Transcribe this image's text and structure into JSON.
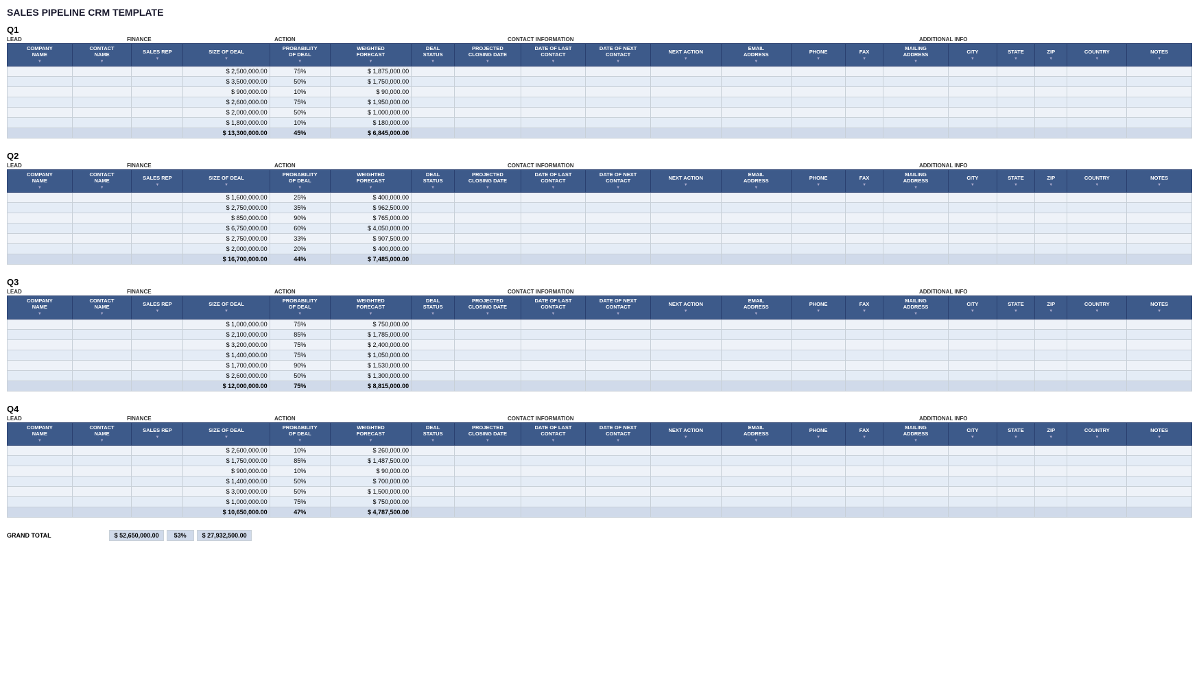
{
  "title": "SALES PIPELINE CRM TEMPLATE",
  "quarters": [
    {
      "label": "Q1",
      "categories": {
        "lead": "LEAD",
        "finance": "FINANCE",
        "action": "ACTION",
        "contact": "CONTACT INFORMATION",
        "addinfo": "ADDITIONAL INFO"
      },
      "columns": [
        "COMPANY NAME",
        "CONTACT NAME",
        "SALES REP",
        "SIZE OF DEAL",
        "PROBABILITY OF DEAL",
        "WEIGHTED FORECAST",
        "DEAL STATUS",
        "PROJECTED CLOSING DATE",
        "DATE OF LAST CONTACT",
        "DATE OF NEXT CONTACT",
        "NEXT ACTION",
        "EMAIL ADDRESS",
        "PHONE",
        "FAX",
        "MAILING ADDRESS",
        "CITY",
        "STATE",
        "ZIP",
        "COUNTRY",
        "NOTES"
      ],
      "rows": [
        {
          "deal": "2,500,000.00",
          "prob": "75%",
          "forecast": "1,875,000.00"
        },
        {
          "deal": "3,500,000.00",
          "prob": "50%",
          "forecast": "1,750,000.00"
        },
        {
          "deal": "900,000.00",
          "prob": "10%",
          "forecast": "90,000.00"
        },
        {
          "deal": "2,600,000.00",
          "prob": "75%",
          "forecast": "1,950,000.00"
        },
        {
          "deal": "2,000,000.00",
          "prob": "50%",
          "forecast": "1,000,000.00"
        },
        {
          "deal": "1,800,000.00",
          "prob": "10%",
          "forecast": "180,000.00"
        }
      ],
      "total": {
        "deal": "13,300,000.00",
        "prob": "45%",
        "forecast": "6,845,000.00"
      }
    },
    {
      "label": "Q2",
      "categories": {
        "lead": "LEAD",
        "finance": "FINANCE",
        "action": "ACTION",
        "contact": "CONTACT INFORMATION",
        "addinfo": "ADDITIONAL INFO"
      },
      "columns": [
        "COMPANY NAME",
        "CONTACT NAME",
        "SALES REP",
        "SIZE OF DEAL",
        "PROBABILITY OF DEAL",
        "WEIGHTED FORECAST",
        "DEAL STATUS",
        "PROJECTED CLOSING DATE",
        "DATE OF LAST CONTACT",
        "DATE OF NEXT CONTACT",
        "NEXT ACTION",
        "EMAIL ADDRESS",
        "PHONE",
        "FAX",
        "MAILING ADDRESS",
        "CITY",
        "STATE",
        "ZIP",
        "COUNTRY",
        "NOTES"
      ],
      "rows": [
        {
          "deal": "1,600,000.00",
          "prob": "25%",
          "forecast": "400,000.00"
        },
        {
          "deal": "2,750,000.00",
          "prob": "35%",
          "forecast": "962,500.00"
        },
        {
          "deal": "850,000.00",
          "prob": "90%",
          "forecast": "765,000.00"
        },
        {
          "deal": "6,750,000.00",
          "prob": "60%",
          "forecast": "4,050,000.00"
        },
        {
          "deal": "2,750,000.00",
          "prob": "33%",
          "forecast": "907,500.00"
        },
        {
          "deal": "2,000,000.00",
          "prob": "20%",
          "forecast": "400,000.00"
        }
      ],
      "total": {
        "deal": "16,700,000.00",
        "prob": "44%",
        "forecast": "7,485,000.00"
      }
    },
    {
      "label": "Q3",
      "categories": {
        "lead": "LEAD",
        "finance": "FINANCE",
        "action": "ACTION",
        "contact": "CONTACT INFORMATION",
        "addinfo": "ADDITIONAL INFO"
      },
      "columns": [
        "COMPANY NAME",
        "CONTACT NAME",
        "SALES REP",
        "SIZE OF DEAL",
        "PROBABILITY OF DEAL",
        "WEIGHTED FORECAST",
        "DEAL STATUS",
        "PROJECTED CLOSING DATE",
        "DATE OF LAST CONTACT",
        "DATE OF NEXT CONTACT",
        "NEXT ACTION",
        "EMAIL ADDRESS",
        "PHONE",
        "FAX",
        "MAILING ADDRESS",
        "CITY",
        "STATE",
        "ZIP",
        "COUNTRY",
        "NOTES"
      ],
      "rows": [
        {
          "deal": "1,000,000.00",
          "prob": "75%",
          "forecast": "750,000.00"
        },
        {
          "deal": "2,100,000.00",
          "prob": "85%",
          "forecast": "1,785,000.00"
        },
        {
          "deal": "3,200,000.00",
          "prob": "75%",
          "forecast": "2,400,000.00"
        },
        {
          "deal": "1,400,000.00",
          "prob": "75%",
          "forecast": "1,050,000.00"
        },
        {
          "deal": "1,700,000.00",
          "prob": "90%",
          "forecast": "1,530,000.00"
        },
        {
          "deal": "2,600,000.00",
          "prob": "50%",
          "forecast": "1,300,000.00"
        }
      ],
      "total": {
        "deal": "12,000,000.00",
        "prob": "75%",
        "forecast": "8,815,000.00"
      }
    },
    {
      "label": "Q4",
      "categories": {
        "lead": "LEAD",
        "finance": "FINANCE",
        "action": "ACTION",
        "contact": "CONTACT INFORMATION",
        "addinfo": "ADDITIONAL INFO"
      },
      "columns": [
        "COMPANY NAME",
        "CONTACT NAME",
        "SALES REP",
        "SIZE OF DEAL",
        "PROBABILITY OF DEAL",
        "WEIGHTED FORECAST",
        "DEAL STATUS",
        "PROJECTED CLOSING DATE",
        "DATE OF LAST CONTACT",
        "DATE OF NEXT CONTACT",
        "NEXT ACTION",
        "EMAIL ADDRESS",
        "PHONE",
        "FAX",
        "MAILING ADDRESS",
        "CITY",
        "STATE",
        "ZIP",
        "COUNTRY",
        "NOTES"
      ],
      "rows": [
        {
          "deal": "2,600,000.00",
          "prob": "10%",
          "forecast": "260,000.00"
        },
        {
          "deal": "1,750,000.00",
          "prob": "85%",
          "forecast": "1,487,500.00"
        },
        {
          "deal": "900,000.00",
          "prob": "10%",
          "forecast": "90,000.00"
        },
        {
          "deal": "1,400,000.00",
          "prob": "50%",
          "forecast": "700,000.00"
        },
        {
          "deal": "3,000,000.00",
          "prob": "50%",
          "forecast": "1,500,000.00"
        },
        {
          "deal": "1,000,000.00",
          "prob": "75%",
          "forecast": "750,000.00"
        }
      ],
      "total": {
        "deal": "10,650,000.00",
        "prob": "47%",
        "forecast": "4,787,500.00"
      }
    }
  ],
  "grand_total": {
    "label": "GRAND TOTAL",
    "deal": "52,650,000.00",
    "prob": "53%",
    "forecast": "27,932,500.00"
  }
}
